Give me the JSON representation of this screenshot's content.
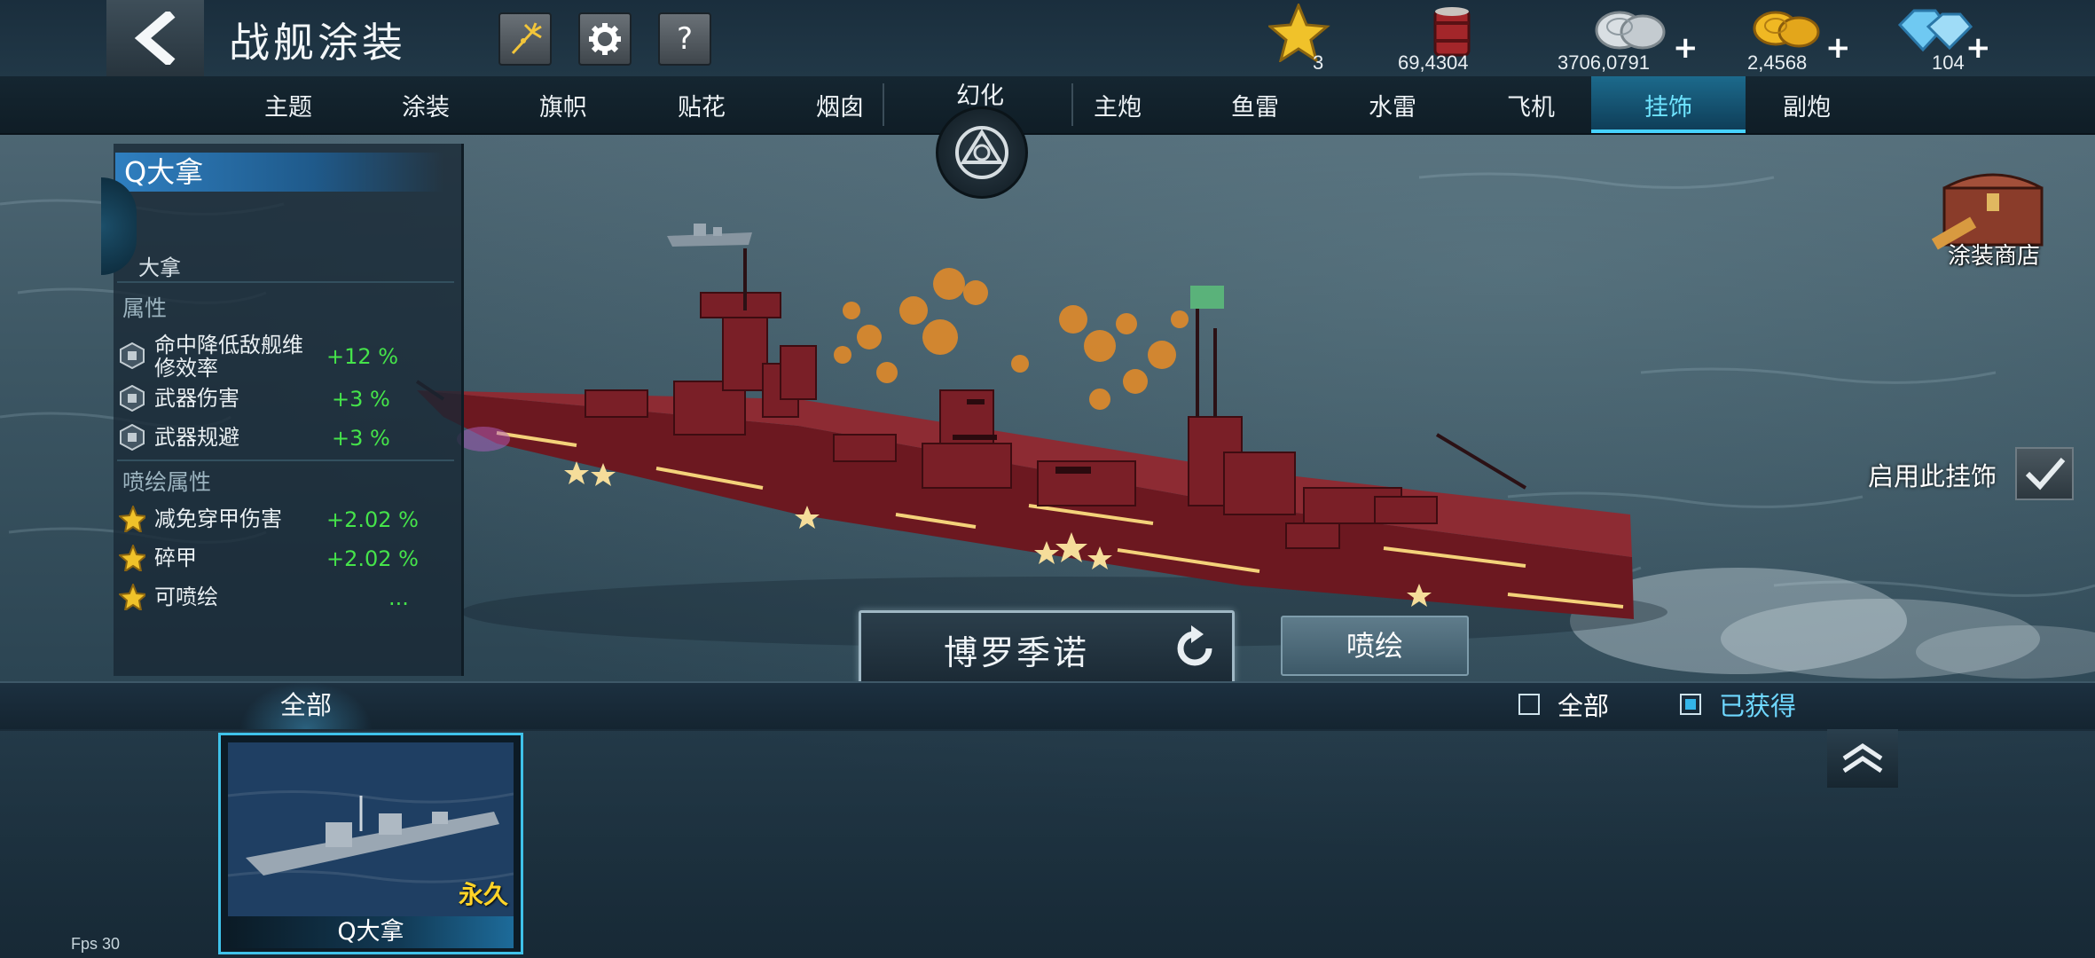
{
  "header": {
    "title": "战舰涂装",
    "buttons": [
      "back",
      "fireworks",
      "settings",
      "help"
    ],
    "help_glyph": "?"
  },
  "resources": [
    {
      "name": "star",
      "value": "3",
      "plus": false
    },
    {
      "name": "fuel-barrel",
      "value": "69,4304",
      "plus": false
    },
    {
      "name": "silver-coins",
      "value": "3706,0791",
      "plus": true
    },
    {
      "name": "gold-coins",
      "value": "2,4568",
      "plus": true
    },
    {
      "name": "diamonds",
      "value": "104",
      "plus": true
    }
  ],
  "tabs_left": [
    "主题",
    "涂装",
    "旗帜",
    "贴花",
    "烟囱"
  ],
  "morph_label": "幻化",
  "tabs_right": [
    "主炮",
    "鱼雷",
    "水雷",
    "飞机",
    "挂饰",
    "副炮"
  ],
  "active_tab": "挂饰",
  "info": {
    "ship_name": "Q大拿",
    "ship_subname_partial": "大拿",
    "attr_heading": "属性",
    "attributes": [
      {
        "name": "命中降低敌舰维修效率",
        "name_line1": "命中降低敌舰维",
        "name_line2": "修效率",
        "value": "+12 %"
      },
      {
        "name": "武器伤害",
        "value": "+3 %"
      },
      {
        "name": "武器规避",
        "value": "+3 %"
      }
    ],
    "spray_heading": "喷绘属性",
    "spray_attributes": [
      {
        "name": "减免穿甲伤害",
        "value": "+2.02 %"
      },
      {
        "name": "碎甲",
        "value": "+2.02 %"
      },
      {
        "name": "可喷绘",
        "value": "..."
      }
    ]
  },
  "actions": {
    "skin_name": "博罗季诺",
    "spray_button": "喷绘",
    "skin_shop": "涂装商店",
    "enable_label": "启用此挂饰",
    "enable_checked": true
  },
  "filter": {
    "category": "全部",
    "options": [
      {
        "label": "全部",
        "checked": false
      },
      {
        "label": "已获得",
        "checked": true
      }
    ]
  },
  "cards": [
    {
      "name": "Q大拿",
      "tag": "永久",
      "selected": true
    }
  ],
  "fps": "Fps 30",
  "colors": {
    "accent": "#46d2ff",
    "positive": "#45e34a",
    "permanent": "#ffd428",
    "hull": "#7a1a24"
  }
}
